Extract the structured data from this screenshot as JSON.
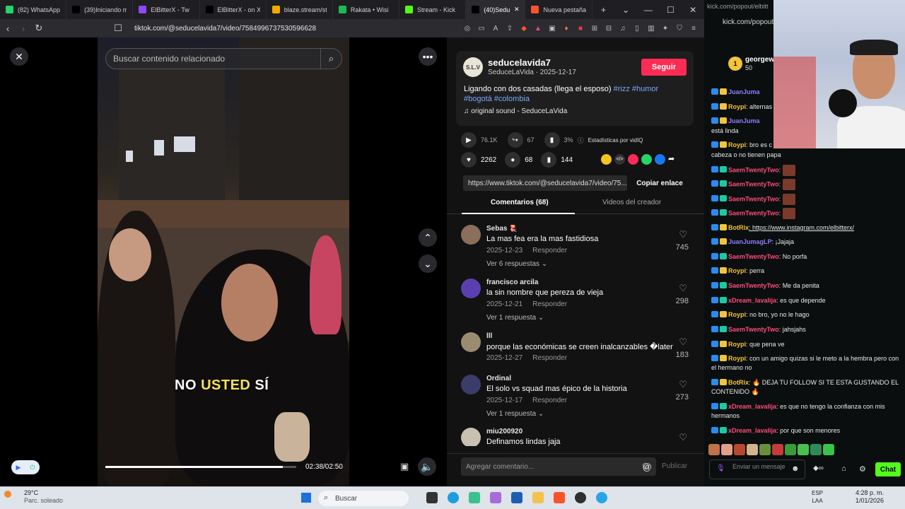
{
  "browser": {
    "tabs": [
      {
        "label": "(82) WhatsApp",
        "icon": "whatsapp-icon",
        "color": "#25d366"
      },
      {
        "label": "(39)Iniciando mi",
        "icon": "tiktok-icon",
        "color": "#000000"
      },
      {
        "label": "ElBitterX - Tw",
        "icon": "twitch-icon",
        "color": "#9146ff"
      },
      {
        "label": "ElBitterX - on X",
        "icon": "x-icon",
        "color": "#000000"
      },
      {
        "label": "blaze.stream/stre",
        "icon": "blaze-icon",
        "color": "#f2a900"
      },
      {
        "label": "Rakata • Wisi",
        "icon": "spotify-icon",
        "color": "#1db954"
      },
      {
        "label": "Stream - Kick",
        "icon": "kick-icon",
        "color": "#53fc18"
      },
      {
        "label": "(40)Sedu",
        "icon": "tiktok-icon",
        "color": "#000000",
        "active": true
      },
      {
        "label": "Nueva pestaña",
        "icon": "brave-icon",
        "color": "#fb542b"
      }
    ],
    "url": "tiktok.com/@seducelavida7/video/7584996737530596628"
  },
  "video": {
    "search_placeholder": "Buscar contenido relacionado",
    "caption_white_1": "NO",
    "caption_yellow": "USTED",
    "caption_white_2": "SÍ",
    "time": "02:38/02:50",
    "progress": 0.93
  },
  "post": {
    "avatar_text": "S.L.V",
    "username": "seducelavida7",
    "subline": "SeduceLaVida · 2025-12-17",
    "follow_label": "Seguir",
    "desc_text": "Ligando con dos casadas (llega el esposo)",
    "desc_tags_1": "#rizz #humor",
    "desc_tags_2": "#bogotá #colombia",
    "sound": "original sound - SeduceLaVida",
    "plays": "76.1K",
    "shares": "67",
    "stat_pct": "3%",
    "stats_label": "Estadísticas por vidIQ",
    "likes": "2262",
    "comments": "68",
    "saves": "144",
    "link": "https://www.tiktok.com/@seducelavida7/video/75...",
    "copy_label": "Copiar enlace",
    "tab_comments": "Comentarios (68)",
    "tab_videos": "Videos del creador",
    "comment_placeholder": "Agregar comentario...",
    "publish_label": "Publicar"
  },
  "comments": [
    {
      "name": "Sebas 🪼",
      "text": "La mas fea era la mas fastidiosa",
      "date": "2025-12-23",
      "reply": "Responder",
      "likes": "745",
      "more": "Ver 6 respuestas ⌄",
      "avcolor": "#8a6f5c"
    },
    {
      "name": "francisco arcila",
      "text": "la sin nombre que pereza de vieja",
      "date": "2025-12-21",
      "reply": "Responder",
      "likes": "298",
      "more": "Ver 1 respuesta ⌄",
      "avcolor": "#5b3fb0"
    },
    {
      "name": "lll",
      "text": "porque las económicas se creen inalcanzables �later",
      "date": "2025-12-27",
      "reply": "Responder",
      "likes": "183",
      "more": "",
      "avcolor": "#9b8b70"
    },
    {
      "name": "Ordinal",
      "text": "El solo vs squad mas épico de la historia",
      "date": "2025-12-17",
      "reply": "Responder",
      "likes": "273",
      "more": "Ver 1 respuesta ⌄",
      "avcolor": "#3c3c6a"
    },
    {
      "name": "miu200920",
      "text": "Definamos lindas jaja",
      "date": "",
      "reply": "",
      "likes": "",
      "more": "",
      "avcolor": "#c8c0b0"
    }
  ],
  "kick": {
    "url1": "kick.com/popout/elbitt",
    "url2": "kick.com/popout/",
    "top_user": "georgew",
    "top_amount": "50",
    "messages": [
      {
        "user": "JuanJuma",
        "text": "",
        "color": "#8e7cff"
      },
      {
        "user": "Roypi",
        "text": ": alternas",
        "color": "#f3c43a"
      },
      {
        "user": "JuanJuma",
        "text": "",
        "color": "#8e7cff"
      },
      {
        "user": "",
        "text": "está linda",
        "color": "#ffffff"
      },
      {
        "user": "Roypi",
        "text": ": bro es c",
        "color": "#f3c43a"
      },
      {
        "user": "",
        "text": "cabeza o no tienen papa",
        "color": "#ffffff"
      },
      {
        "user": "SaemTwentyTwo",
        "text": ":",
        "color": "#ff4b7a"
      },
      {
        "user": "SaemTwentyTwo",
        "text": ":",
        "color": "#ff4b7a"
      },
      {
        "user": "SaemTwentyTwo",
        "text": ":",
        "color": "#ff4b7a"
      },
      {
        "user": "SaemTwentyTwo",
        "text": ":",
        "color": "#ff4b7a"
      },
      {
        "user": "BotRix",
        "text": ": https://www.instagram.com/elbitterx/",
        "color": "#f3c43a"
      },
      {
        "user": "JuanJumagLP",
        "text": ": ¡Jajaja",
        "color": "#8e7cff"
      },
      {
        "user": "SaemTwentyTwo",
        "text": ": No porfa",
        "color": "#ff4b7a"
      },
      {
        "user": "Roypi",
        "text": ": perra",
        "color": "#f3c43a"
      },
      {
        "user": "SaemTwentyTwo",
        "text": ": Me da penita",
        "color": "#ff4b7a"
      },
      {
        "user": "xDream_lavalija",
        "text": ": es que depende",
        "color": "#ff4b7a"
      },
      {
        "user": "Roypi",
        "text": ": no bro, yo no le hago",
        "color": "#f3c43a"
      },
      {
        "user": "SaemTwentyTwo",
        "text": ": jahsjahs",
        "color": "#ff4b7a"
      },
      {
        "user": "Roypi",
        "text": ": que pena ve",
        "color": "#f3c43a"
      },
      {
        "user": "Roypi",
        "text": ": con un amigo quizas si le meto a la hembra pero con el hermano no",
        "color": "#f3c43a"
      },
      {
        "user": "BotRix",
        "text": ": 🔥 DEJA TU FOLLOW SI TE ESTA GUSTANDO EL CONTENIDO 🔥",
        "color": "#f3c43a"
      },
      {
        "user": "xDream_lavalija",
        "text": ": es que no tengo la confianza con mis hermanos",
        "color": "#ff4b7a"
      },
      {
        "user": "xDream_lavalija",
        "text": ": por que son menores",
        "color": "#ff4b7a"
      }
    ],
    "input_placeholder": "Enviar un mensaje",
    "chat_label": "Chat"
  },
  "taskbar": {
    "temp": "29°C",
    "weather": "Parc. soleado",
    "search": "Buscar",
    "lang1": "ESP",
    "lang2": "LAA",
    "time": "4:28 p. m.",
    "date": "1/01/2026"
  }
}
